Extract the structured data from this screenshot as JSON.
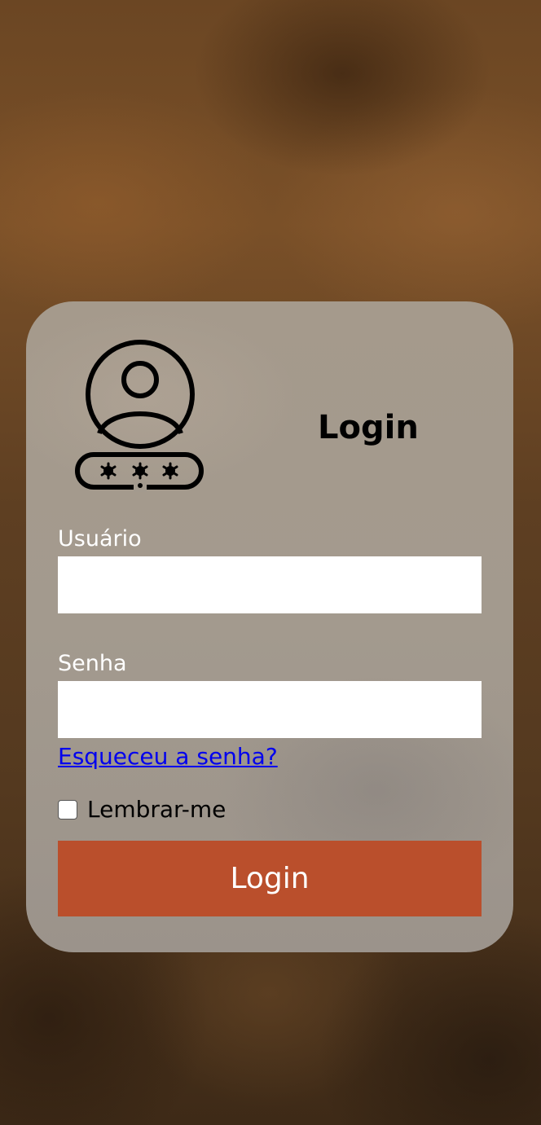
{
  "login_form": {
    "title": "Login",
    "avatar_icon": "user-password-icon",
    "username": {
      "label": "Usuário",
      "value": "",
      "placeholder": ""
    },
    "password": {
      "label": "Senha",
      "value": "",
      "placeholder": ""
    },
    "forgot_password_link": "Esqueceu a senha?",
    "remember_me": {
      "label": "Lembrar-me",
      "checked": false
    },
    "submit_label": "Login"
  },
  "colors": {
    "accent": "#ba4f2c",
    "link": "#0000ee",
    "card": "#a39a8e"
  }
}
